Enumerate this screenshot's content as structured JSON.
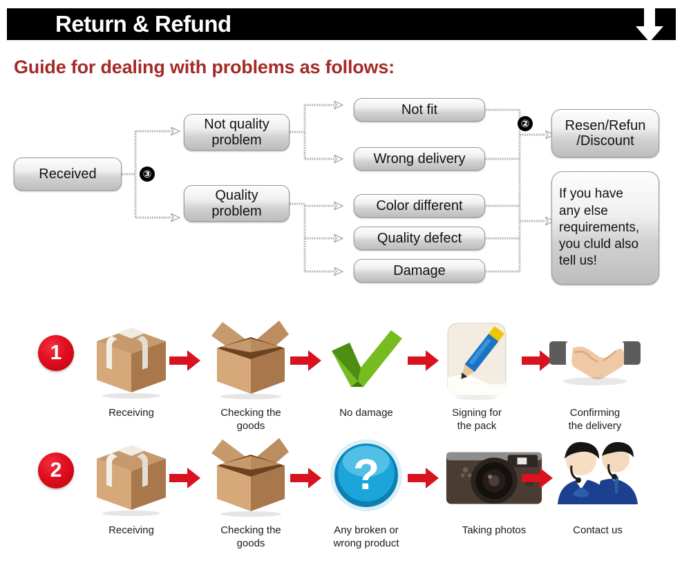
{
  "header": {
    "title": "Return & Refund",
    "arrow_icon": "arrow-down-icon",
    "bar_color": "#000000",
    "text_color": "#ffffff"
  },
  "guide": {
    "heading": "Guide for dealing with problems as follows:",
    "heading_color": "#A42A28"
  },
  "flowchart": {
    "start": {
      "label": "Received"
    },
    "badge_branch": "③",
    "badge_merge": "②",
    "branches": [
      {
        "label": "Not quality\nproblem",
        "line1": "Not quality",
        "line2": "problem"
      },
      {
        "label": "Quality\nproblem",
        "line1": "Quality",
        "line2": "problem"
      }
    ],
    "reasons_not_quality": [
      {
        "label": "Not fit"
      },
      {
        "label": "Wrong delivery"
      }
    ],
    "reasons_quality": [
      {
        "label": "Color different"
      },
      {
        "label": "Quality defect"
      },
      {
        "label": "Damage"
      }
    ],
    "outcomes": [
      {
        "line1": "Resen/Refun",
        "line2": "/Discount"
      },
      {
        "lines": [
          "If you have",
          "any else",
          "requirements,",
          "you cluld also",
          "tell us!"
        ]
      }
    ]
  },
  "process": {
    "arrow_color": "#D8121E",
    "badge_color": "#E00E1E",
    "rows": [
      {
        "number": "1",
        "steps": [
          {
            "label": "Receiving",
            "icon": "sealed-box-icon"
          },
          {
            "label": "Checking the\ngoods",
            "icon": "open-box-icon"
          },
          {
            "label": "No damage",
            "icon": "green-check-icon"
          },
          {
            "label": "Signing for\nthe pack",
            "icon": "pencil-signing-icon"
          },
          {
            "label": "Confirming\nthe delivery",
            "icon": "handshake-icon"
          }
        ]
      },
      {
        "number": "2",
        "steps": [
          {
            "label": "Receiving",
            "icon": "sealed-box-icon"
          },
          {
            "label": "Checking the\ngoods",
            "icon": "open-box-icon"
          },
          {
            "label": "Any broken or\nwrong product",
            "icon": "question-mark-icon"
          },
          {
            "label": "Taking photos",
            "icon": "camera-icon"
          },
          {
            "label": "Contact us",
            "icon": "support-agents-icon"
          }
        ]
      }
    ]
  }
}
